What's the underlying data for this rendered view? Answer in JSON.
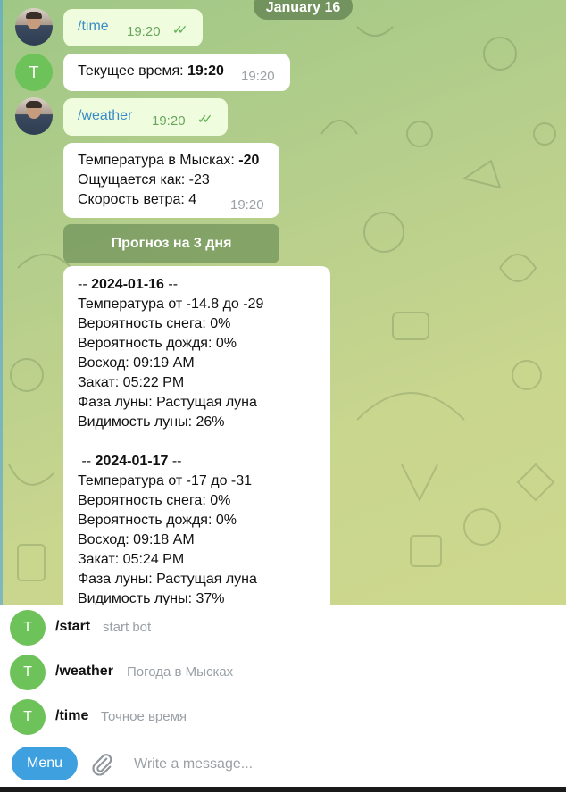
{
  "chat": {
    "date": "January 16",
    "messages": [
      {
        "type": "out",
        "text": "/time",
        "time": "19:20"
      },
      {
        "type": "in",
        "avatar": "T",
        "prefix": "Текущее время: ",
        "bold": "19:20",
        "time": "19:20"
      },
      {
        "type": "out",
        "text": "/weather",
        "time": "19:20"
      },
      {
        "type": "in",
        "lines": [
          {
            "prefix": "Температура в Мысках: ",
            "bold": "-20"
          },
          {
            "text": "Ощущается как: -23"
          },
          {
            "text": "Скорость ветра: 4"
          }
        ],
        "time": "19:20"
      }
    ],
    "forecast_button": "Прогноз на 3 дня",
    "forecast": {
      "day1": {
        "header_prefix": "-- ",
        "date": "2024-01-16",
        "header_suffix": " --",
        "temp": "Температура от -14.8 до -29",
        "snow": "Вероятность снега: 0%",
        "rain": "Вероятность дождя: 0%",
        "sunrise": "Восход: 09:19 AM",
        "sunset": "Закат: 05:22 PM",
        "moon_phase": "Фаза луны: Растущая луна",
        "moon_vis": "Видимость луны: 26%"
      },
      "day2": {
        "header_prefix": " -- ",
        "date": "2024-01-17",
        "header_suffix": " --",
        "temp": "Температура от -17 до -31",
        "snow": "Вероятность снега: 0%",
        "rain": "Вероятность дождя: 0%",
        "sunrise": "Восход: 09:18 AM",
        "sunset": "Закат: 05:24 PM",
        "moon_phase": "Фаза луны: Растущая луна",
        "moon_vis": "Видимость луны: 37%"
      }
    }
  },
  "commands": [
    {
      "avatar": "T",
      "name": "/start",
      "desc": "start bot"
    },
    {
      "avatar": "T",
      "name": "/weather",
      "desc": "Погода в Мысках"
    },
    {
      "avatar": "T",
      "name": "/time",
      "desc": "Точное время"
    }
  ],
  "composer": {
    "menu_label": "Menu",
    "placeholder": "Write a message..."
  },
  "colors": {
    "accent": "#3fa0e0",
    "bot_avatar": "#6ec25a",
    "outgoing_bubble": "#effdde"
  }
}
